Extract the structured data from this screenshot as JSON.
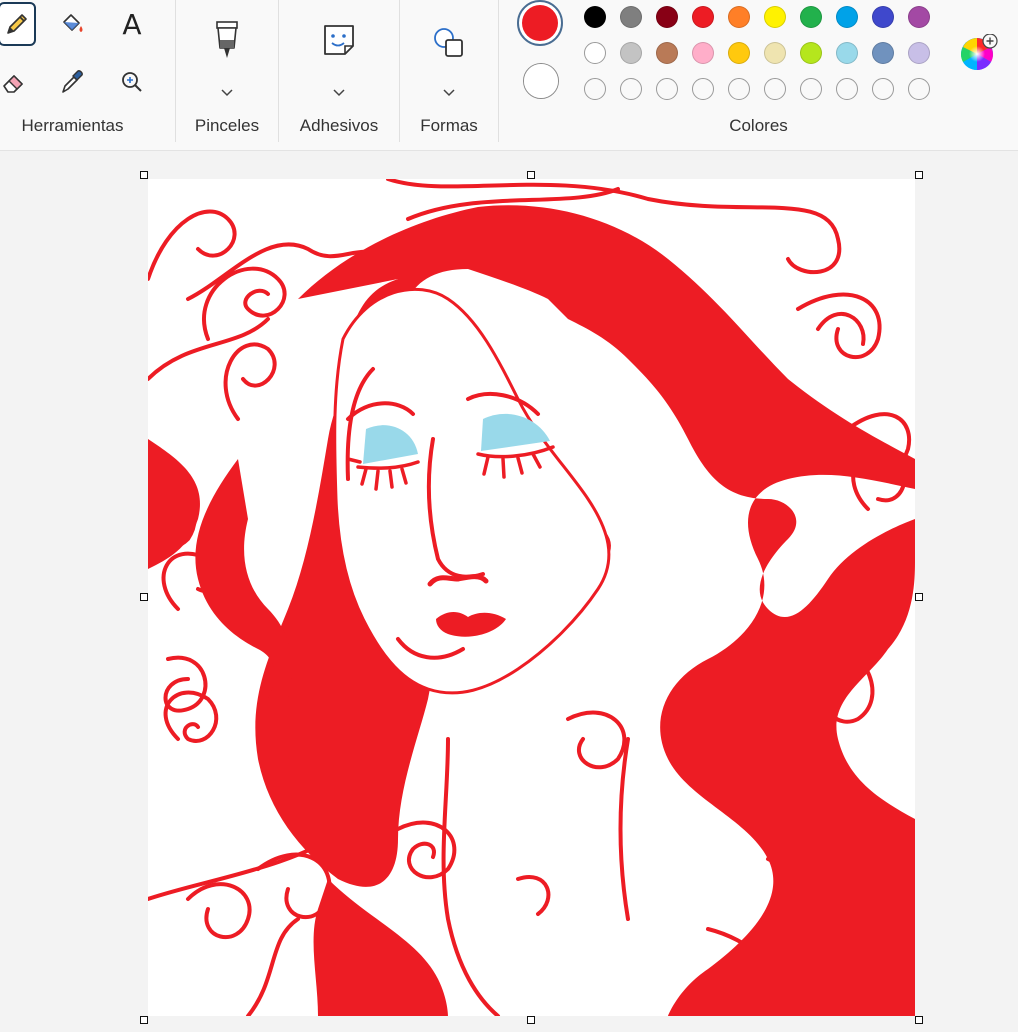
{
  "ribbon": {
    "groups": {
      "tools": {
        "label": "Herramientas"
      },
      "brushes": {
        "label": "Pinceles"
      },
      "stickers": {
        "label": "Adhesivos"
      },
      "shapes": {
        "label": "Formas"
      },
      "colors": {
        "label": "Colores"
      }
    },
    "tools": [
      {
        "name": "pencil-icon",
        "selected": true
      },
      {
        "name": "fill-bucket-icon",
        "selected": false
      },
      {
        "name": "text-icon",
        "glyph": "A",
        "selected": false
      },
      {
        "name": "eraser-icon",
        "selected": false
      },
      {
        "name": "color-picker-icon",
        "selected": false
      },
      {
        "name": "magnifier-icon",
        "selected": false
      }
    ],
    "colors": {
      "primary": "#ed1c24",
      "secondary": "#ffffff",
      "palette_row1": [
        "#000000",
        "#7f7f7f",
        "#880015",
        "#ed1c24",
        "#ff7f27",
        "#fff200",
        "#22b14c",
        "#00a2e8",
        "#3f48cc",
        "#a349a4"
      ],
      "palette_row2": [
        "#ffffff",
        "#c3c3c3",
        "#b97a57",
        "#ffaec9",
        "#ffc90e",
        "#efe4b0",
        "#b5e61d",
        "#99d9ea",
        "#7092be",
        "#c8bfe7"
      ],
      "palette_row3_empty_count": 10
    }
  },
  "canvas": {
    "drawing_colors": {
      "hair": "#ed1c24",
      "eyes": "#99d9ea",
      "background": "#ffffff"
    }
  }
}
